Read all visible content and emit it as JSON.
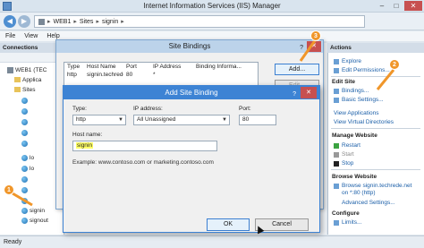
{
  "window": {
    "title": "Internet Information Services (IIS) Manager"
  },
  "address": {
    "crumbs": [
      "WEB1",
      "Sites",
      "signin"
    ]
  },
  "menu": {
    "items": [
      "File",
      "View",
      "Help"
    ]
  },
  "connections": {
    "header": "Connections",
    "tree": [
      {
        "label": "WEB1 (TEC",
        "type": "server"
      },
      {
        "label": "Applica",
        "type": "folder"
      },
      {
        "label": "Sites",
        "type": "folder"
      },
      {
        "label": "",
        "type": "site"
      },
      {
        "label": "",
        "type": "site"
      },
      {
        "label": "",
        "type": "site"
      },
      {
        "label": "",
        "type": "site"
      },
      {
        "label": "",
        "type": "site"
      },
      {
        "label": "lo",
        "type": "site"
      },
      {
        "label": "lo",
        "type": "site"
      },
      {
        "label": "",
        "type": "site"
      },
      {
        "label": "",
        "type": "site"
      },
      {
        "label": "",
        "type": "site"
      },
      {
        "label": "signin",
        "type": "site"
      },
      {
        "label": "signout",
        "type": "site"
      }
    ]
  },
  "site_bindings": {
    "title": "Site Bindings",
    "columns": [
      "Type",
      "Host Name",
      "Port",
      "IP Address",
      "Binding Informa..."
    ],
    "rows": [
      [
        "http",
        "signin.techrede...",
        "80",
        "*",
        ""
      ]
    ],
    "buttons": {
      "add": "Add...",
      "edit": "Edit..."
    }
  },
  "add_binding": {
    "title": "Add Site Binding",
    "type_label": "Type:",
    "type_value": "http",
    "ip_label": "IP address:",
    "ip_value": "All Unassigned",
    "port_label": "Port:",
    "port_value": "80",
    "host_label": "Host name:",
    "host_value": "signin",
    "example": "Example: www.contoso.com or marketing.contoso.com",
    "ok": "OK",
    "cancel": "Cancel"
  },
  "actions": {
    "header": "Actions",
    "items": [
      {
        "label": "Explore",
        "kind": "link"
      },
      {
        "label": "Edit Permissions...",
        "kind": "link"
      },
      {
        "label": "Edit Site",
        "kind": "head"
      },
      {
        "label": "Bindings...",
        "kind": "link"
      },
      {
        "label": "Basic Settings...",
        "kind": "link"
      },
      {
        "label": "View Applications",
        "kind": "link"
      },
      {
        "label": "View Virtual Directories",
        "kind": "link"
      },
      {
        "label": "Manage Website",
        "kind": "head"
      },
      {
        "label": "Restart",
        "kind": "link"
      },
      {
        "label": "Start",
        "kind": "disabled"
      },
      {
        "label": "Stop",
        "kind": "link"
      },
      {
        "label": "Browse Website",
        "kind": "head"
      },
      {
        "label": "Browse signin.techrede.net",
        "kind": "link"
      },
      {
        "label": "on *:80 (http)",
        "kind": "link"
      },
      {
        "label": "Advanced Settings...",
        "kind": "link"
      },
      {
        "label": "Configure",
        "kind": "head"
      },
      {
        "label": "Limits...",
        "kind": "link"
      }
    ]
  },
  "status": {
    "text": "Ready"
  },
  "badges": [
    "1",
    "2",
    "3"
  ]
}
